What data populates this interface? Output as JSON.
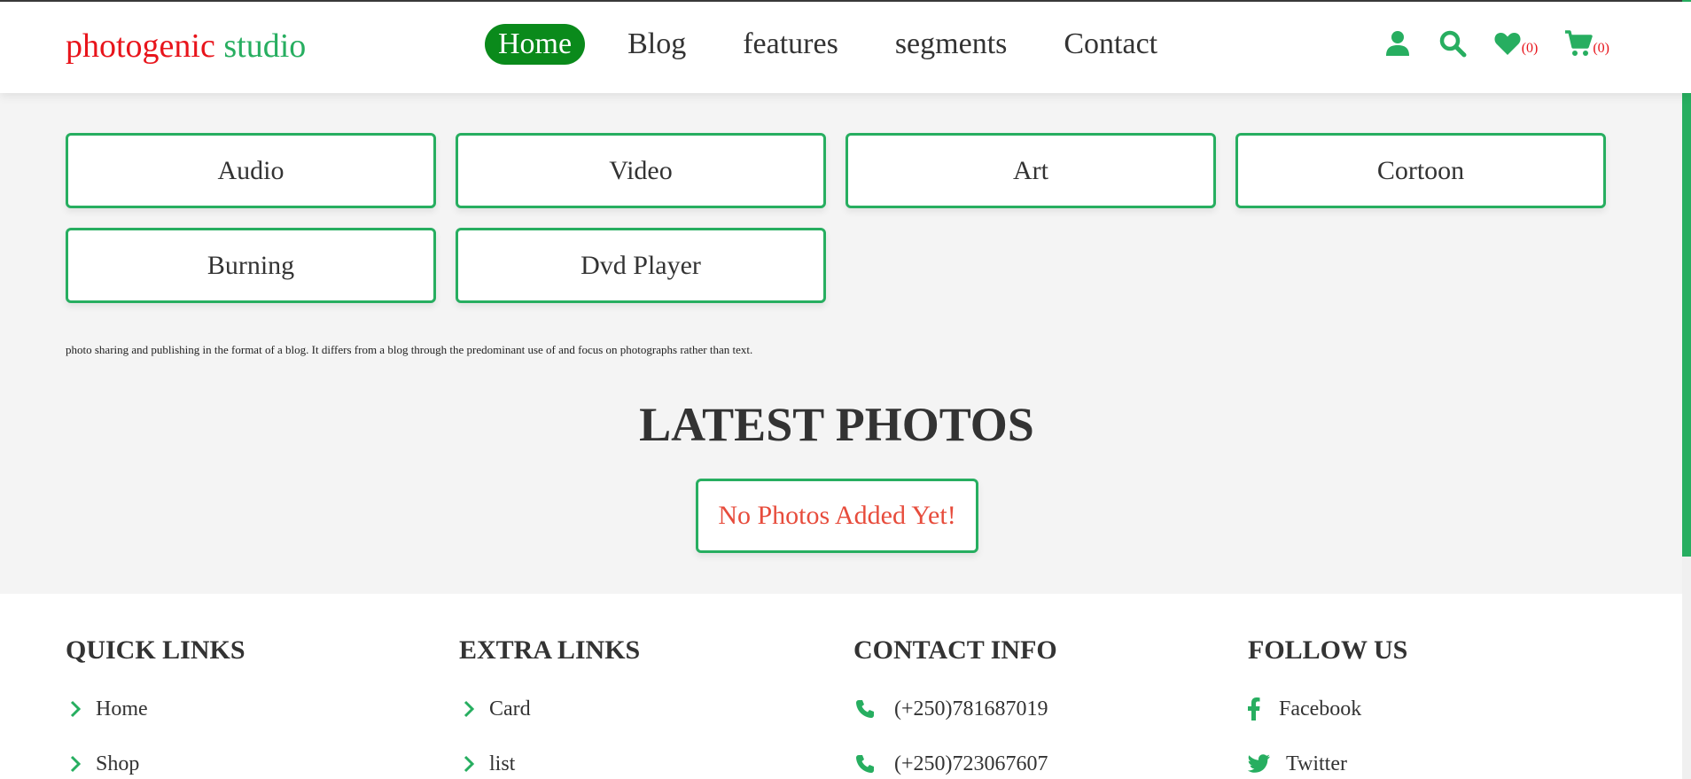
{
  "brand": {
    "part1": "photogenic",
    "part2": "studio"
  },
  "nav": [
    {
      "label": "Home",
      "active": true
    },
    {
      "label": "Blog"
    },
    {
      "label": "features"
    },
    {
      "label": "segments"
    },
    {
      "label": "Contact"
    }
  ],
  "header_icons": {
    "user": "user-icon",
    "search": "search-icon",
    "wishlist": {
      "icon": "heart-icon",
      "count": "(0)"
    },
    "cart": {
      "icon": "cart-icon",
      "count": "(0)"
    }
  },
  "segments": [
    "Audio",
    "Video",
    "Art",
    "Cortoon",
    "Burning",
    "Dvd Player"
  ],
  "blurb": "photo sharing and publishing in the format of a blog. It differs from a blog through the predominant use of and focus on photographs rather than text.",
  "latest": {
    "title": "LATEST PHOTOS",
    "empty_message": "No Photos Added Yet!"
  },
  "footer": {
    "quick_links": {
      "title": "QUICK LINKS",
      "items": [
        "Home",
        "Shop"
      ]
    },
    "extra_links": {
      "title": "EXTRA LINKS",
      "items": [
        "Card",
        "list"
      ]
    },
    "contact_info": {
      "title": "CONTACT INFO",
      "items": [
        "(+250)781687019",
        "(+250)723067607"
      ]
    },
    "follow_us": {
      "title": "FOLLOW US",
      "items": [
        "Facebook",
        "Twitter"
      ]
    }
  },
  "colors": {
    "accent": "#27ae60",
    "brand_red": "#e8141b",
    "active_nav": "#0a8a1b",
    "alert": "#e74c3c"
  }
}
